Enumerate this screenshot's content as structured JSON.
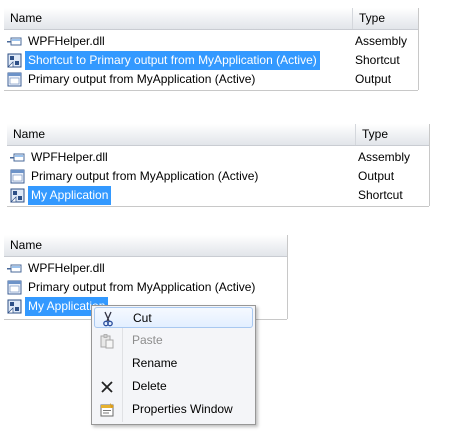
{
  "panels": [
    {
      "columns": {
        "name": "Name",
        "type": "Type"
      },
      "rows": [
        {
          "icon": "dll-file-icon",
          "name": "WPFHelper.dll",
          "type": "Assembly",
          "selected": false
        },
        {
          "icon": "shortcut-icon",
          "name": "Shortcut to Primary output from MyApplication (Active)",
          "type": "Shortcut",
          "selected": true
        },
        {
          "icon": "output-icon",
          "name": "Primary output from MyApplication (Active)",
          "type": "Output",
          "selected": false
        }
      ]
    },
    {
      "columns": {
        "name": "Name",
        "type": "Type"
      },
      "rows": [
        {
          "icon": "dll-file-icon",
          "name": "WPFHelper.dll",
          "type": "Assembly",
          "selected": false
        },
        {
          "icon": "output-icon",
          "name": "Primary output from MyApplication (Active)",
          "type": "Output",
          "selected": false
        },
        {
          "icon": "shortcut-icon",
          "name": "My Application",
          "type": "Shortcut",
          "selected": true
        }
      ]
    },
    {
      "columns": {
        "name": "Name"
      },
      "rows": [
        {
          "icon": "dll-file-icon",
          "name": "WPFHelper.dll",
          "selected": false
        },
        {
          "icon": "output-icon",
          "name": "Primary output from MyApplication (Active)",
          "selected": false
        },
        {
          "icon": "shortcut-icon",
          "name": "My Application",
          "selected": true
        }
      ]
    }
  ],
  "context_menu": {
    "items": [
      {
        "icon": "scissors-icon",
        "label": "Cut",
        "highlighted": true,
        "disabled": false
      },
      {
        "icon": "paste-icon",
        "label": "Paste",
        "highlighted": false,
        "disabled": true
      },
      {
        "icon": "",
        "label": "Rename",
        "highlighted": false,
        "disabled": false
      },
      {
        "icon": "delete-x-icon",
        "label": "Delete",
        "highlighted": false,
        "disabled": false
      },
      {
        "icon": "properties-window-icon",
        "label": "Properties Window",
        "highlighted": false,
        "disabled": false
      }
    ]
  },
  "colors": {
    "selection": "#3399ff",
    "menu_highlight": "#e3efff",
    "header": "#eef0f3"
  }
}
